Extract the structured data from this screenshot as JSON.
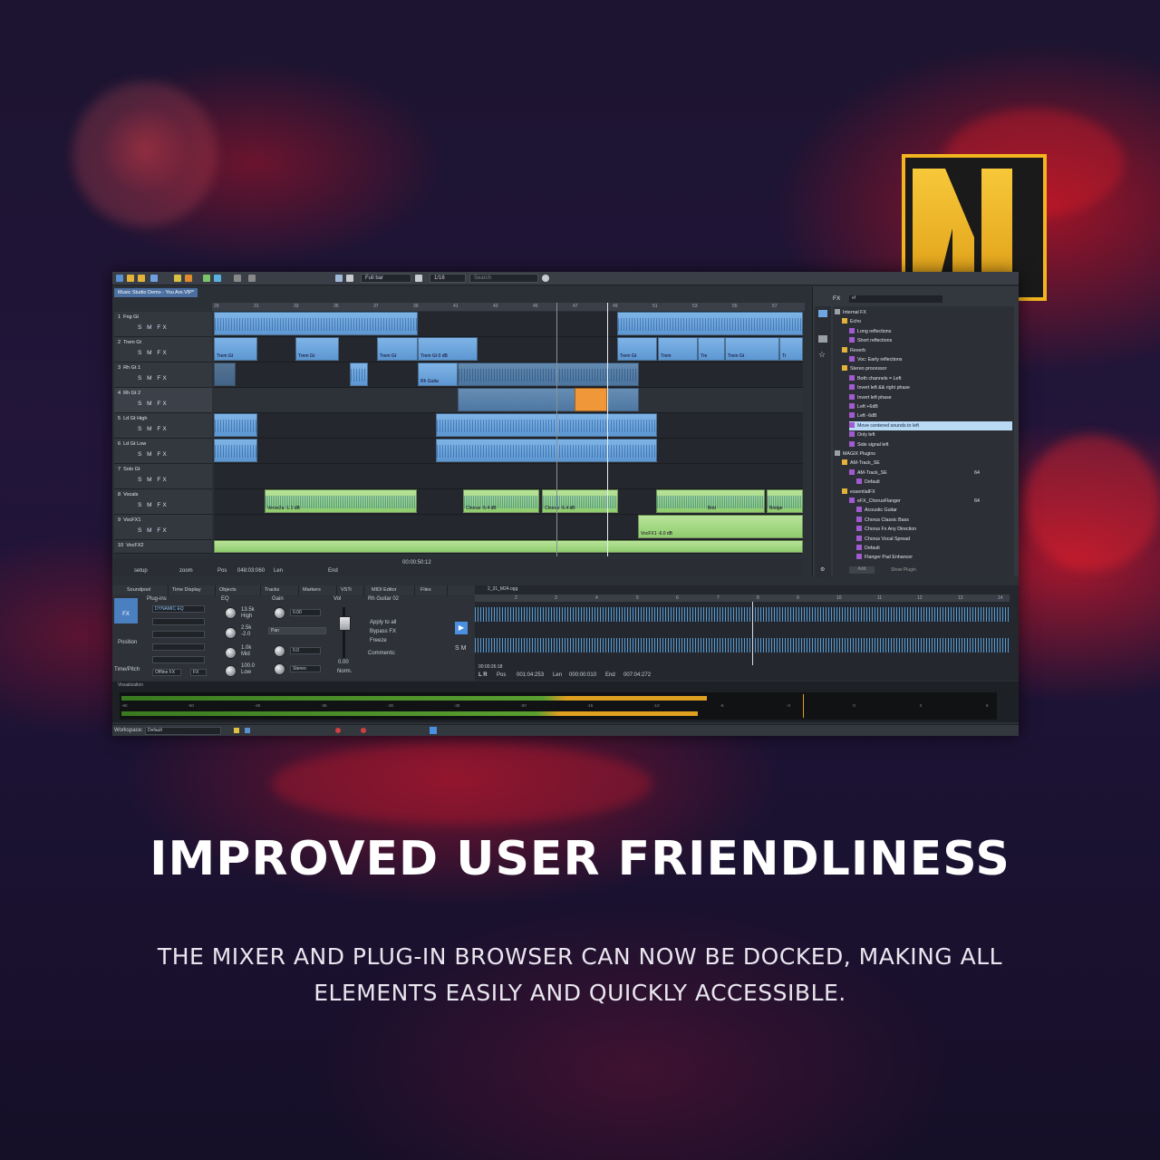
{
  "promo": {
    "headline": "IMPROVED USER FRIENDLINESS",
    "description": "THE MIXER AND PLUG-IN BROWSER CAN NOW BE DOCKED, MAKING ALL ELEMENTS EASILY AND QUICKLY ACCESSIBLE."
  },
  "colors": {
    "accent_blue": "#5d97d2",
    "clip_green": "#8fcd6d",
    "logo_gold": "#f2b51f",
    "meter_orange": "#e0a020"
  },
  "toolbar": {
    "zoom_mode": "Full bar",
    "grid": "1/16",
    "search_placeholder": "Search"
  },
  "project_tab": "Music Studio Demo - You Are.VIP*",
  "ruler": [
    "29",
    "31",
    "33",
    "35",
    "37",
    "39",
    "41",
    "43",
    "45",
    "47",
    "49",
    "51",
    "53",
    "55",
    "57"
  ],
  "tracks": [
    {
      "num": "1",
      "name": "Fng Gt"
    },
    {
      "num": "2",
      "name": "Trem Gt"
    },
    {
      "num": "3",
      "name": "Rh Gt 1"
    },
    {
      "num": "4",
      "name": "Rh Gt 2"
    },
    {
      "num": "5",
      "name": "Ld Gt High"
    },
    {
      "num": "6",
      "name": "Ld Gt Low"
    },
    {
      "num": "7",
      "name": "Solo Gt"
    },
    {
      "num": "8",
      "name": "Vocals"
    },
    {
      "num": "9",
      "name": "VocFX1"
    },
    {
      "num": "10",
      "name": "VocFX2"
    }
  ],
  "track_buttons": "S M FX",
  "clips": {
    "trem1": "Trem Gt",
    "trem2": "Trem Gt",
    "trem3": "Trem Gt",
    "trem4": "Trem Gt 0 dB",
    "trem5": "Trem Gt",
    "trem6": "Trem",
    "trem7": "Tre",
    "trem8": "Trem Gt",
    "trem9": "Tr",
    "rh": "Rh Guita",
    "ch1": "Chorus -5.4 dB",
    "ch2": "Chorus -5.4 dB",
    "verse": "Verse2a -1.1 dB",
    "brid": "Brid",
    "bridge": "Bridge",
    "vocfx": "VocFX1 -6.0 dB"
  },
  "track_footer": {
    "setup": "setup",
    "zoom": "zoom",
    "pos_label": "Pos",
    "pos": "048:03:060",
    "len_label": "Len",
    "end_label": "End",
    "time": "00:00:50:12"
  },
  "plugins": {
    "tab": "FX",
    "filter": "ef",
    "items": [
      {
        "t": "Internal FX",
        "lvl": 0
      },
      {
        "t": "Echo",
        "lvl": 1
      },
      {
        "t": "Long reflections",
        "lvl": 2
      },
      {
        "t": "Short reflections",
        "lvl": 2
      },
      {
        "t": "Reverb",
        "lvl": 1
      },
      {
        "t": "Voc: Early reflections",
        "lvl": 2
      },
      {
        "t": "Stereo processor",
        "lvl": 1
      },
      {
        "t": "Both channels = Left",
        "lvl": 2
      },
      {
        "t": "Invert left && right phase",
        "lvl": 2
      },
      {
        "t": "Invert left phase",
        "lvl": 2
      },
      {
        "t": "Left +6dB",
        "lvl": 2
      },
      {
        "t": "Left -6dB",
        "lvl": 2
      },
      {
        "t": "Move centered sounds to left",
        "lvl": 2,
        "sel": true
      },
      {
        "t": "Only left",
        "lvl": 2
      },
      {
        "t": "Side signal left",
        "lvl": 2
      },
      {
        "t": "MAGIX Plugins",
        "lvl": 0
      },
      {
        "t": "AM-Track_SE",
        "lvl": 1
      },
      {
        "t": "AM-Track_SE",
        "lvl": 2,
        "badge": "64"
      },
      {
        "t": "Default",
        "lvl": 3
      },
      {
        "t": "essentialFX",
        "lvl": 1
      },
      {
        "t": "eFX_ChorusFlanger",
        "lvl": 2,
        "badge": "64"
      },
      {
        "t": "Acoustic Guitar",
        "lvl": 3
      },
      {
        "t": "Chorus Classic Bass",
        "lvl": 3
      },
      {
        "t": "Chorus Fx Any Direction",
        "lvl": 3
      },
      {
        "t": "Chorus Vocal Spread",
        "lvl": 3
      },
      {
        "t": "Default",
        "lvl": 3
      },
      {
        "t": "Flanger Pad Enhancer",
        "lvl": 3
      }
    ],
    "add": "Add",
    "show_plugin": "Show Plugin"
  },
  "lower_tabs": [
    "Soundpool",
    "Time Display",
    "Objects",
    "Tracks",
    "Markers",
    "VSTi",
    "MIDI Editor",
    "Files"
  ],
  "mixer": {
    "fx": "FX",
    "position": "Position",
    "timepitch": "Time/Pitch",
    "plugins_label": "Plug-ins",
    "eq": "EQ",
    "gain": "Gain",
    "vol": "Vol",
    "slot1": "DYNAMIC EQ",
    "offline": "Offline FX",
    "fx2": "FX",
    "hi_val": "13.5k",
    "hi": "High",
    "mid_val": "2.5k",
    "mid_gain": "-2.0",
    "mid": "Mid",
    "lo_val": "1.0k",
    "lo_gain": "100.0",
    "lo": "Low",
    "gain_val": "0.00",
    "pan": "Pan",
    "pan_val": "0.0",
    "stereo": "Stereo",
    "vol_val": "0.00",
    "norm": "Norm.",
    "track": "Rh Guitar 02",
    "apply": "Apply to all",
    "bypass": "Bypass FX",
    "freeze": "Freeze",
    "comments": "Comments:",
    "sm": "S M"
  },
  "editor": {
    "file": "2_31_M24.ogg",
    "ruler": [
      "2",
      "3",
      "4",
      "5",
      "6",
      "7",
      "8",
      "9",
      "10",
      "11",
      "12",
      "13",
      "14"
    ],
    "time": "00:00:26:18",
    "pos_label": "Pos",
    "pos": "001:04:253",
    "len_label": "Len",
    "len": "000:00:010",
    "end_label": "End",
    "end": "007:04:272",
    "lr": "L R"
  },
  "visualization": {
    "title": "Visualization",
    "scale": [
      "-60",
      "-50",
      "-40",
      "-35",
      "-30",
      "-25",
      "-20",
      "-15",
      "-10",
      "-6",
      "-3",
      "0",
      "3",
      "6"
    ],
    "levels": {
      "left": 0.67,
      "right": 0.66,
      "peak": 0.78
    }
  },
  "statusbar": {
    "workspace_label": "Workspace:",
    "workspace": "Default"
  }
}
